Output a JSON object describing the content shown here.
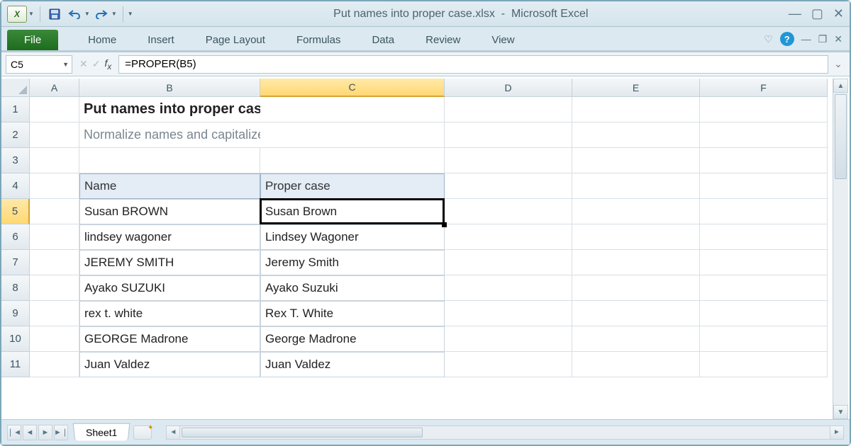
{
  "titlebar": {
    "document": "Put names into proper case.xlsx",
    "app": "Microsoft Excel"
  },
  "ribbon": {
    "file": "File",
    "tabs": [
      "Home",
      "Insert",
      "Page Layout",
      "Formulas",
      "Data",
      "Review",
      "View"
    ]
  },
  "namebox": "C5",
  "formula": "=PROPER(B5)",
  "columns": [
    "A",
    "B",
    "C",
    "D",
    "E",
    "F"
  ],
  "rows": [
    "1",
    "2",
    "3",
    "4",
    "5",
    "6",
    "7",
    "8",
    "9",
    "10",
    "11"
  ],
  "active": {
    "row": 5,
    "col": "C"
  },
  "content": {
    "title": "Put names into proper case",
    "subtitle": "Normalize names and capitalize first letters",
    "headers": {
      "name": "Name",
      "proper": "Proper case"
    },
    "data": [
      {
        "name": "Susan BROWN",
        "proper": "Susan Brown"
      },
      {
        "name": "lindsey wagoner",
        "proper": "Lindsey Wagoner"
      },
      {
        "name": "JEREMY SMITH",
        "proper": "Jeremy Smith"
      },
      {
        "name": "Ayako SUZUKI",
        "proper": "Ayako Suzuki"
      },
      {
        "name": "rex t. white",
        "proper": "Rex T. White"
      },
      {
        "name": "GEORGE Madrone",
        "proper": "George Madrone"
      },
      {
        "name": "Juan Valdez",
        "proper": "Juan Valdez"
      }
    ]
  },
  "sheet_tab": "Sheet1"
}
